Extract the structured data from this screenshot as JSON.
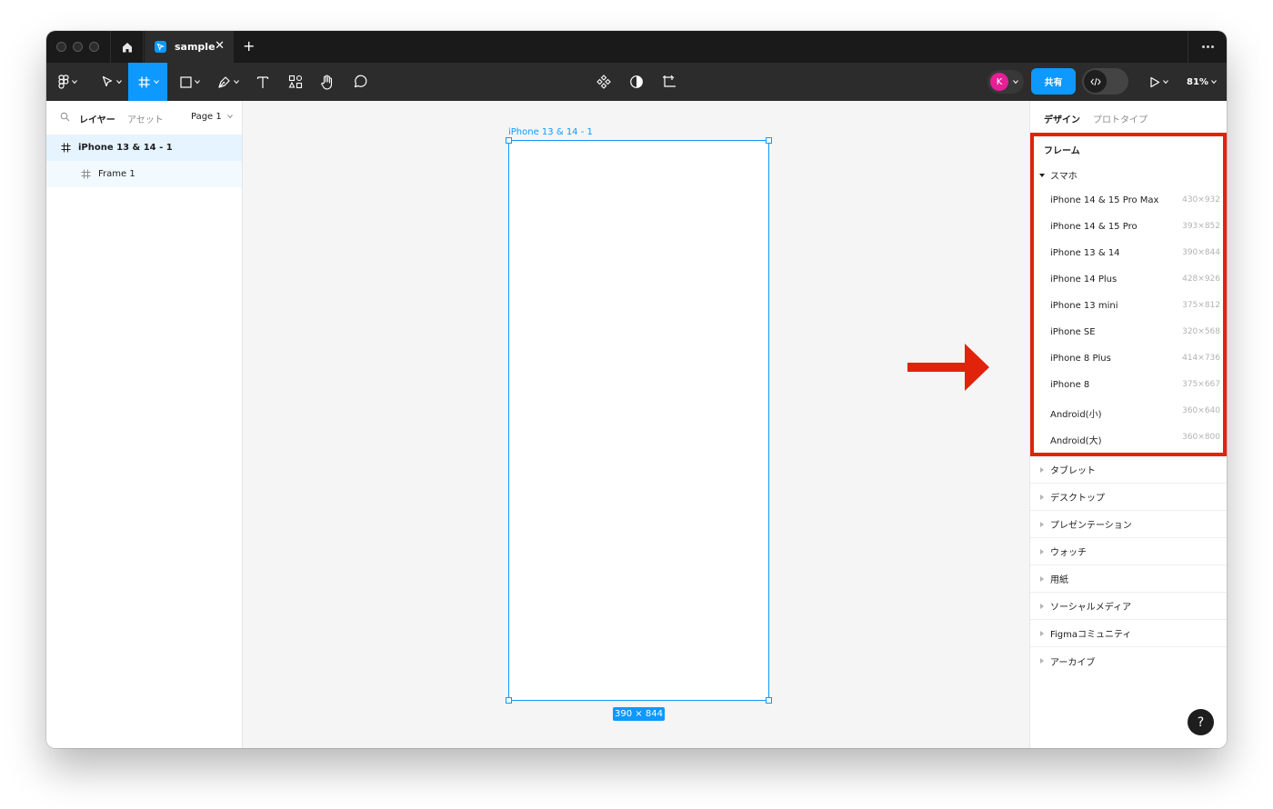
{
  "titlebar": {
    "tab_title": "sample",
    "tab_close": "✕",
    "new_tab": "+"
  },
  "toolbar": {
    "avatar_initial": "K",
    "share_label": "共有",
    "zoom_label": "81%"
  },
  "left_panel": {
    "tab_layers": "レイヤー",
    "tab_assets": "アセット",
    "page_label": "Page 1",
    "layers": [
      {
        "name": "iPhone 13 & 14 - 1"
      },
      {
        "name": "Frame 1"
      }
    ]
  },
  "canvas": {
    "frame_label": "iPhone 13 & 14 - 1",
    "frame_size": "390 × 844"
  },
  "right_panel": {
    "tab_design": "デザイン",
    "tab_prototype": "プロトタイプ",
    "frame_title": "フレーム",
    "phone_category": "スマホ",
    "presets": [
      {
        "name": "iPhone 14 & 15 Pro Max",
        "dim": "430×932"
      },
      {
        "name": "iPhone 14 & 15 Pro",
        "dim": "393×852"
      },
      {
        "name": "iPhone 13 & 14",
        "dim": "390×844"
      },
      {
        "name": "iPhone 14 Plus",
        "dim": "428×926"
      },
      {
        "name": "iPhone 13 mini",
        "dim": "375×812"
      },
      {
        "name": "iPhone SE",
        "dim": "320×568"
      },
      {
        "name": "iPhone 8 Plus",
        "dim": "414×736"
      },
      {
        "name": "iPhone 8",
        "dim": "375×667"
      },
      {
        "name": "Android(小)",
        "dim": "360×640"
      },
      {
        "name": "Android(大)",
        "dim": "360×800"
      }
    ],
    "categories": [
      {
        "label": "タブレット"
      },
      {
        "label": "デスクトップ"
      },
      {
        "label": "プレゼンテーション"
      },
      {
        "label": "ウォッチ"
      },
      {
        "label": "用紙"
      },
      {
        "label": "ソーシャルメディア"
      },
      {
        "label": "Figmaコミュニティ"
      },
      {
        "label": "アーカイブ"
      }
    ],
    "help_label": "?"
  },
  "colors": {
    "accent": "#0d99ff",
    "highlight": "#e0230a",
    "avatar": "#e61e97"
  }
}
